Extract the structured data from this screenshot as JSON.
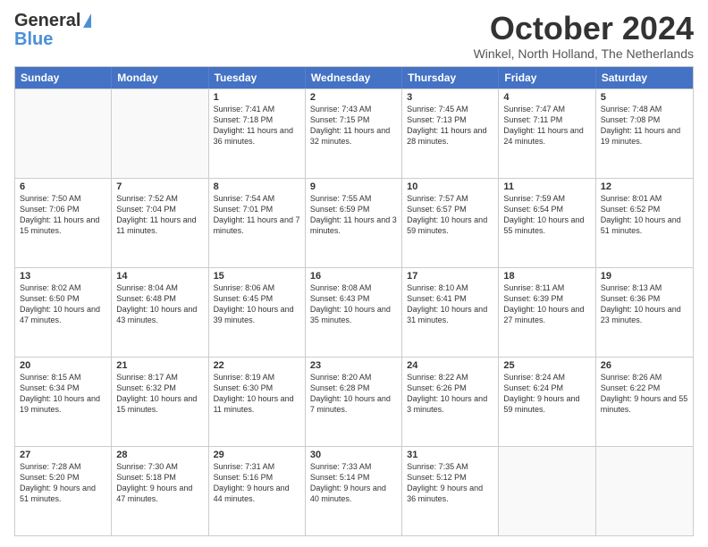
{
  "header": {
    "logo_line1": "General",
    "logo_line2": "Blue",
    "month_title": "October 2024",
    "location": "Winkel, North Holland, The Netherlands"
  },
  "weekdays": [
    "Sunday",
    "Monday",
    "Tuesday",
    "Wednesday",
    "Thursday",
    "Friday",
    "Saturday"
  ],
  "weeks": [
    [
      {
        "day": "",
        "sunrise": "",
        "sunset": "",
        "daylight": ""
      },
      {
        "day": "",
        "sunrise": "",
        "sunset": "",
        "daylight": ""
      },
      {
        "day": "1",
        "sunrise": "Sunrise: 7:41 AM",
        "sunset": "Sunset: 7:18 PM",
        "daylight": "Daylight: 11 hours and 36 minutes."
      },
      {
        "day": "2",
        "sunrise": "Sunrise: 7:43 AM",
        "sunset": "Sunset: 7:15 PM",
        "daylight": "Daylight: 11 hours and 32 minutes."
      },
      {
        "day": "3",
        "sunrise": "Sunrise: 7:45 AM",
        "sunset": "Sunset: 7:13 PM",
        "daylight": "Daylight: 11 hours and 28 minutes."
      },
      {
        "day": "4",
        "sunrise": "Sunrise: 7:47 AM",
        "sunset": "Sunset: 7:11 PM",
        "daylight": "Daylight: 11 hours and 24 minutes."
      },
      {
        "day": "5",
        "sunrise": "Sunrise: 7:48 AM",
        "sunset": "Sunset: 7:08 PM",
        "daylight": "Daylight: 11 hours and 19 minutes."
      }
    ],
    [
      {
        "day": "6",
        "sunrise": "Sunrise: 7:50 AM",
        "sunset": "Sunset: 7:06 PM",
        "daylight": "Daylight: 11 hours and 15 minutes."
      },
      {
        "day": "7",
        "sunrise": "Sunrise: 7:52 AM",
        "sunset": "Sunset: 7:04 PM",
        "daylight": "Daylight: 11 hours and 11 minutes."
      },
      {
        "day": "8",
        "sunrise": "Sunrise: 7:54 AM",
        "sunset": "Sunset: 7:01 PM",
        "daylight": "Daylight: 11 hours and 7 minutes."
      },
      {
        "day": "9",
        "sunrise": "Sunrise: 7:55 AM",
        "sunset": "Sunset: 6:59 PM",
        "daylight": "Daylight: 11 hours and 3 minutes."
      },
      {
        "day": "10",
        "sunrise": "Sunrise: 7:57 AM",
        "sunset": "Sunset: 6:57 PM",
        "daylight": "Daylight: 10 hours and 59 minutes."
      },
      {
        "day": "11",
        "sunrise": "Sunrise: 7:59 AM",
        "sunset": "Sunset: 6:54 PM",
        "daylight": "Daylight: 10 hours and 55 minutes."
      },
      {
        "day": "12",
        "sunrise": "Sunrise: 8:01 AM",
        "sunset": "Sunset: 6:52 PM",
        "daylight": "Daylight: 10 hours and 51 minutes."
      }
    ],
    [
      {
        "day": "13",
        "sunrise": "Sunrise: 8:02 AM",
        "sunset": "Sunset: 6:50 PM",
        "daylight": "Daylight: 10 hours and 47 minutes."
      },
      {
        "day": "14",
        "sunrise": "Sunrise: 8:04 AM",
        "sunset": "Sunset: 6:48 PM",
        "daylight": "Daylight: 10 hours and 43 minutes."
      },
      {
        "day": "15",
        "sunrise": "Sunrise: 8:06 AM",
        "sunset": "Sunset: 6:45 PM",
        "daylight": "Daylight: 10 hours and 39 minutes."
      },
      {
        "day": "16",
        "sunrise": "Sunrise: 8:08 AM",
        "sunset": "Sunset: 6:43 PM",
        "daylight": "Daylight: 10 hours and 35 minutes."
      },
      {
        "day": "17",
        "sunrise": "Sunrise: 8:10 AM",
        "sunset": "Sunset: 6:41 PM",
        "daylight": "Daylight: 10 hours and 31 minutes."
      },
      {
        "day": "18",
        "sunrise": "Sunrise: 8:11 AM",
        "sunset": "Sunset: 6:39 PM",
        "daylight": "Daylight: 10 hours and 27 minutes."
      },
      {
        "day": "19",
        "sunrise": "Sunrise: 8:13 AM",
        "sunset": "Sunset: 6:36 PM",
        "daylight": "Daylight: 10 hours and 23 minutes."
      }
    ],
    [
      {
        "day": "20",
        "sunrise": "Sunrise: 8:15 AM",
        "sunset": "Sunset: 6:34 PM",
        "daylight": "Daylight: 10 hours and 19 minutes."
      },
      {
        "day": "21",
        "sunrise": "Sunrise: 8:17 AM",
        "sunset": "Sunset: 6:32 PM",
        "daylight": "Daylight: 10 hours and 15 minutes."
      },
      {
        "day": "22",
        "sunrise": "Sunrise: 8:19 AM",
        "sunset": "Sunset: 6:30 PM",
        "daylight": "Daylight: 10 hours and 11 minutes."
      },
      {
        "day": "23",
        "sunrise": "Sunrise: 8:20 AM",
        "sunset": "Sunset: 6:28 PM",
        "daylight": "Daylight: 10 hours and 7 minutes."
      },
      {
        "day": "24",
        "sunrise": "Sunrise: 8:22 AM",
        "sunset": "Sunset: 6:26 PM",
        "daylight": "Daylight: 10 hours and 3 minutes."
      },
      {
        "day": "25",
        "sunrise": "Sunrise: 8:24 AM",
        "sunset": "Sunset: 6:24 PM",
        "daylight": "Daylight: 9 hours and 59 minutes."
      },
      {
        "day": "26",
        "sunrise": "Sunrise: 8:26 AM",
        "sunset": "Sunset: 6:22 PM",
        "daylight": "Daylight: 9 hours and 55 minutes."
      }
    ],
    [
      {
        "day": "27",
        "sunrise": "Sunrise: 7:28 AM",
        "sunset": "Sunset: 5:20 PM",
        "daylight": "Daylight: 9 hours and 51 minutes."
      },
      {
        "day": "28",
        "sunrise": "Sunrise: 7:30 AM",
        "sunset": "Sunset: 5:18 PM",
        "daylight": "Daylight: 9 hours and 47 minutes."
      },
      {
        "day": "29",
        "sunrise": "Sunrise: 7:31 AM",
        "sunset": "Sunset: 5:16 PM",
        "daylight": "Daylight: 9 hours and 44 minutes."
      },
      {
        "day": "30",
        "sunrise": "Sunrise: 7:33 AM",
        "sunset": "Sunset: 5:14 PM",
        "daylight": "Daylight: 9 hours and 40 minutes."
      },
      {
        "day": "31",
        "sunrise": "Sunrise: 7:35 AM",
        "sunset": "Sunset: 5:12 PM",
        "daylight": "Daylight: 9 hours and 36 minutes."
      },
      {
        "day": "",
        "sunrise": "",
        "sunset": "",
        "daylight": ""
      },
      {
        "day": "",
        "sunrise": "",
        "sunset": "",
        "daylight": ""
      }
    ]
  ]
}
